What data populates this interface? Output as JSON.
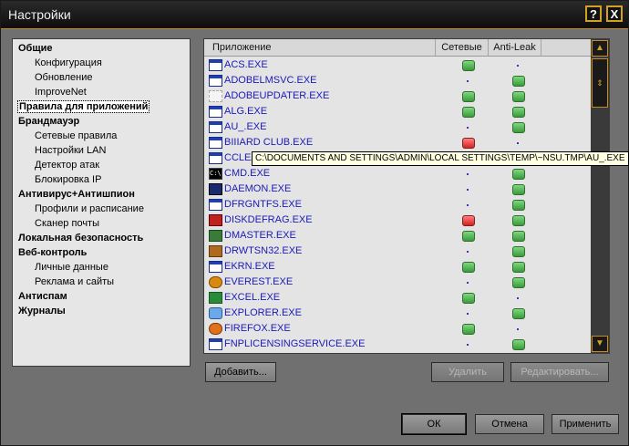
{
  "window": {
    "title": "Настройки",
    "help_label": "?",
    "close_label": "X"
  },
  "tree": [
    {
      "label": "Общие",
      "type": "cat"
    },
    {
      "label": "Конфигурация",
      "type": "sub"
    },
    {
      "label": "Обновление",
      "type": "sub"
    },
    {
      "label": "ImproveNet",
      "type": "sub"
    },
    {
      "label": "Правила для приложений",
      "type": "cat",
      "selected": true
    },
    {
      "label": "Брандмауэр",
      "type": "cat"
    },
    {
      "label": "Сетевые правила",
      "type": "sub"
    },
    {
      "label": "Настройки LAN",
      "type": "sub"
    },
    {
      "label": "Детектор атак",
      "type": "sub"
    },
    {
      "label": "Блокировка IP",
      "type": "sub"
    },
    {
      "label": "Антивирус+Антишпион",
      "type": "cat"
    },
    {
      "label": "Профили и расписание",
      "type": "sub"
    },
    {
      "label": "Сканер почты",
      "type": "sub"
    },
    {
      "label": "Локальная безопасность",
      "type": "cat"
    },
    {
      "label": "Веб-контроль",
      "type": "cat"
    },
    {
      "label": "Личные данные",
      "type": "sub"
    },
    {
      "label": "Реклама и сайты",
      "type": "sub"
    },
    {
      "label": "Антиспам",
      "type": "cat"
    },
    {
      "label": "Журналы",
      "type": "cat"
    }
  ],
  "list": {
    "columns": {
      "app": "Приложение",
      "net": "Сетевые",
      "leak": "Anti-Leak"
    },
    "rows": [
      {
        "name": "ACS.EXE",
        "icon": "window",
        "net": "green",
        "leak": "dot"
      },
      {
        "name": "ADOBELMSVC.EXE",
        "icon": "window",
        "net": "dot",
        "leak": "green"
      },
      {
        "name": "ADOBEUPDATER.EXE",
        "icon": "blank",
        "net": "green",
        "leak": "green"
      },
      {
        "name": "ALG.EXE",
        "icon": "window",
        "net": "green",
        "leak": "green"
      },
      {
        "name": "AU_.EXE",
        "icon": "window",
        "net": "dot",
        "leak": "green"
      },
      {
        "name": "BIIIARD CLUB.EXE",
        "icon": "window",
        "net": "red",
        "leak": "dot"
      },
      {
        "name": "CCLEANER.EXE",
        "icon": "window",
        "net": "dot",
        "leak": "green"
      },
      {
        "name": "CMD.EXE",
        "icon": "cmd",
        "net": "dot",
        "leak": "green"
      },
      {
        "name": "DAEMON.EXE",
        "icon": "daemon",
        "net": "dot",
        "leak": "green"
      },
      {
        "name": "DFRGNTFS.EXE",
        "icon": "window",
        "net": "dot",
        "leak": "green"
      },
      {
        "name": "DISKDEFRAG.EXE",
        "icon": "disk",
        "net": "red",
        "leak": "green"
      },
      {
        "name": "DMASTER.EXE",
        "icon": "dmaster",
        "net": "green",
        "leak": "green"
      },
      {
        "name": "DRWTSN32.EXE",
        "icon": "drwtsn",
        "net": "dot",
        "leak": "green"
      },
      {
        "name": "EKRN.EXE",
        "icon": "window",
        "net": "green",
        "leak": "green"
      },
      {
        "name": "EVEREST.EXE",
        "icon": "everest",
        "net": "dot",
        "leak": "green"
      },
      {
        "name": "EXCEL.EXE",
        "icon": "excel",
        "net": "green",
        "leak": "dot"
      },
      {
        "name": "EXPLORER.EXE",
        "icon": "explorer",
        "net": "dot",
        "leak": "green"
      },
      {
        "name": "FIREFOX.EXE",
        "icon": "firefox",
        "net": "green",
        "leak": "dot"
      },
      {
        "name": "FNPLICENSINGSERVICE.EXE",
        "icon": "window",
        "net": "dot",
        "leak": "green"
      }
    ],
    "tooltip": "C:\\DOCUMENTS AND SETTINGS\\ADMIN\\LOCAL SETTINGS\\TEMP\\~NSU.TMP\\AU_.EXE"
  },
  "buttons": {
    "add": "Добавить...",
    "remove": "Удалить",
    "edit": "Редактировать...",
    "ok": "ОК",
    "cancel": "Отмена",
    "apply": "Применить"
  },
  "colors": {
    "accent": "#c98a1a",
    "status_green": "#4caf4c",
    "status_red": "#e03030",
    "link_blue": "#1a1ab8"
  }
}
